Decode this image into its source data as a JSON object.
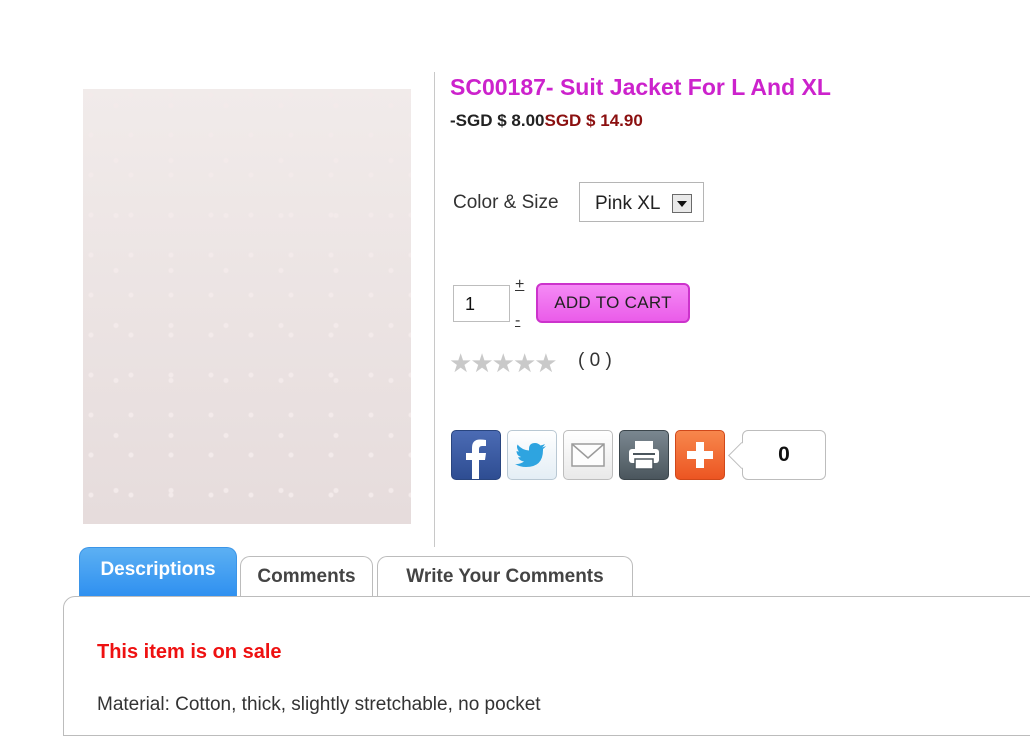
{
  "product": {
    "title": "SC00187- Suit Jacket For L And XL",
    "price_old": "-SGD $ 8.00",
    "price_new": "SGD $ 14.90",
    "image_alt": "product-photo-pink-suit-jacket"
  },
  "options": {
    "label": "Color & Size",
    "selected": "Pink XL"
  },
  "cart": {
    "quantity": "1",
    "plus": "+",
    "minus": "-",
    "button_label": "ADD TO CART"
  },
  "rating": {
    "stars_filled": 0,
    "stars_total": 5,
    "count_text": "( 0 )"
  },
  "share": {
    "icons": [
      "facebook-icon",
      "twitter-icon",
      "email-icon",
      "print-icon",
      "plus-icon"
    ],
    "count": "0"
  },
  "tabs": [
    {
      "label": "Descriptions",
      "active": true
    },
    {
      "label": "Comments",
      "active": false
    },
    {
      "label": "Write Your Comments",
      "active": false
    }
  ],
  "description": {
    "sale_text": "This item is on sale",
    "material_text": "Material: Cotton, thick, slightly stretchable, no pocket"
  },
  "colors": {
    "title": "#cc22cc",
    "price_new": "#8b1010",
    "cart_button": "#ea5ce9",
    "active_tab": "#2d8ff0",
    "sale_text": "#ee1111"
  }
}
